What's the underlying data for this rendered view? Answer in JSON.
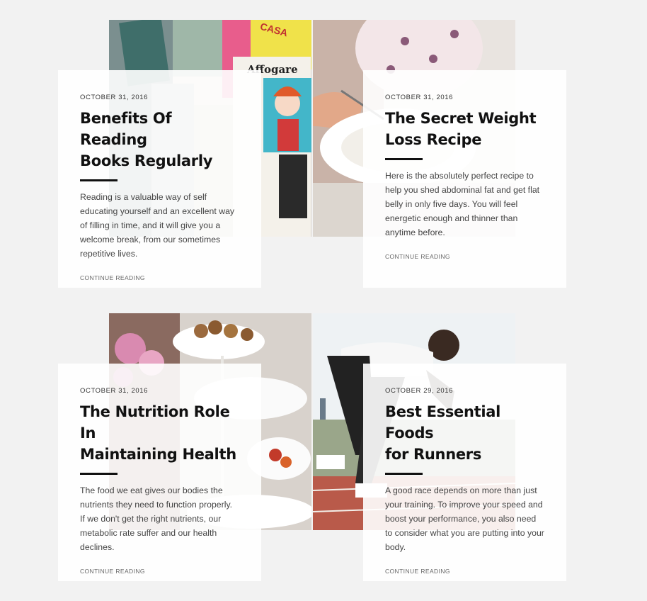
{
  "posts": [
    {
      "date": "OCTOBER 31, 2016",
      "title_line1": "Benefits Of Reading",
      "title_line2": "Books Regularly",
      "excerpt": "Reading is a valuable way of self educating yourself and an excellent way of filling in time, and it will give you a welcome break, from our sometimes repetitive lives.",
      "more": "CONTINUE READING",
      "image": "magazines-photo",
      "image_text_1": "Affogare",
      "image_text_2": "CASA"
    },
    {
      "date": "OCTOBER 31, 2016",
      "title_line1": "The Secret Weight",
      "title_line2": "Loss Recipe",
      "excerpt": "Here is the absolutely perfect recipe to help you shed abdominal fat and get flat belly in only five days. You will feel energetic enough and thinner than anytime before.",
      "more": "CONTINUE READING",
      "image": "woman-eating-photo"
    },
    {
      "date": "OCTOBER 31, 2016",
      "title_line1": "The Nutrition Role In",
      "title_line2": "Maintaining Health",
      "excerpt": "The food we eat gives our bodies the nutrients they need to function properly. If we don't get the right nutrients, our metabolic rate suffer and our health declines.",
      "more": "CONTINUE READING",
      "image": "pastry-stand-photo"
    },
    {
      "date": "OCTOBER 29, 2016",
      "title_line1": "Best Essential Foods",
      "title_line2": "for Runners",
      "excerpt": "A good race depends on more than just your training. To improve your speed and boost your performance, you also need to consider what you are putting into your body.",
      "more": "CONTINUE READING",
      "image": "runner-photo"
    }
  ]
}
